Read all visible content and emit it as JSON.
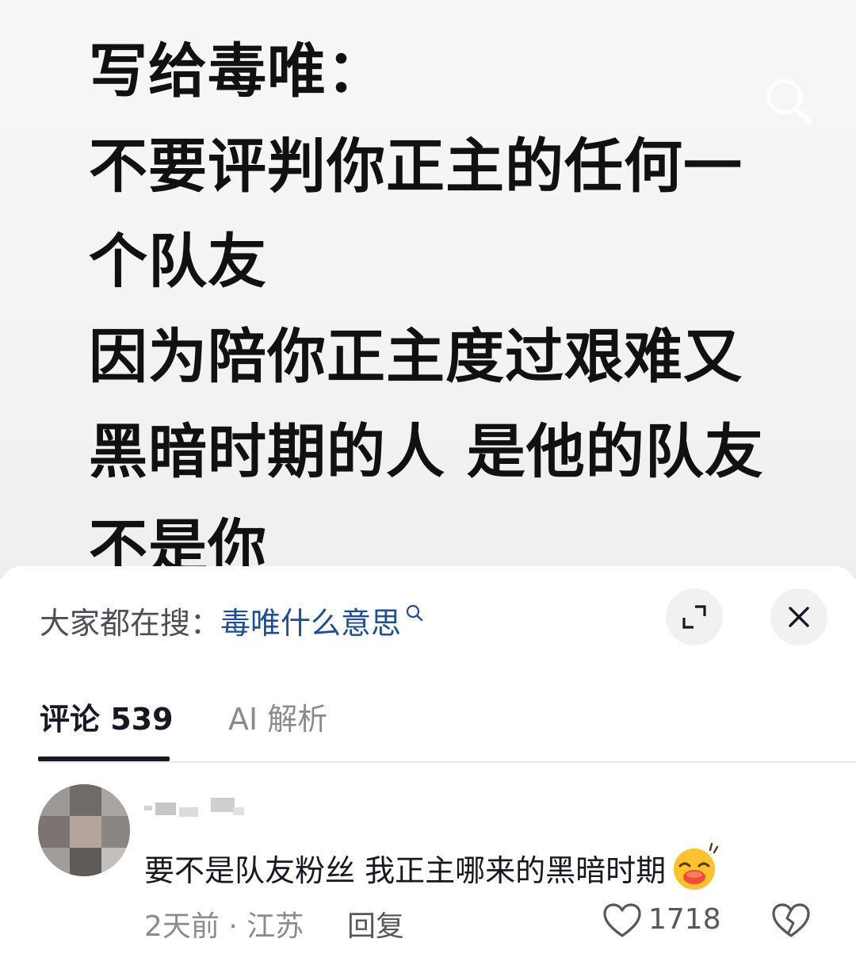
{
  "post": {
    "lines": [
      "写给毒唯：",
      "不要评判你正主的任何一",
      "个队友",
      "因为陪你正主度过艰难又",
      "黑暗时期的人 是他的队友",
      "不是你"
    ],
    "icon": "search-icon"
  },
  "suggested_search": {
    "prefix": "大家都在搜：",
    "query": "毒唯什么意思",
    "icon": "search-icon"
  },
  "buttons": {
    "expand_icon": "expand-icon",
    "close_icon": "close-icon"
  },
  "tabs": [
    {
      "label": "评论 539",
      "active": true
    },
    {
      "label": "AI 解析",
      "active": false
    }
  ],
  "comment": {
    "text": "要不是队友粉丝 我正主哪来的黑暗时期",
    "emoji": "laughing-emoji",
    "time_location": "2天前 · 江苏",
    "reply_label": "回复",
    "like_count": "1718"
  },
  "colors": {
    "link": "#1d4f91",
    "text": "#161823",
    "muted": "#8a8b91"
  }
}
